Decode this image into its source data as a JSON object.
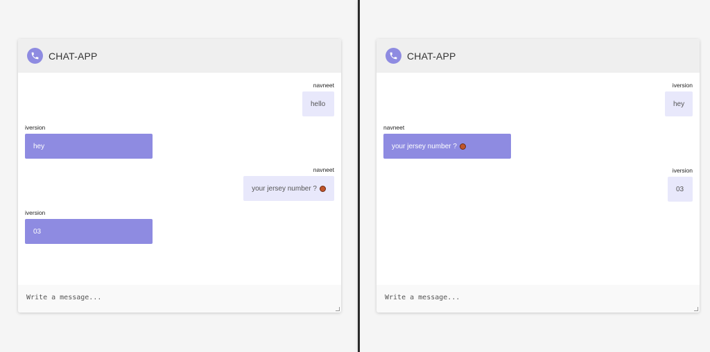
{
  "app": {
    "title": "CHAT-APP",
    "brand_color": "#8e8be1"
  },
  "composer": {
    "placeholder": "Write a message..."
  },
  "left_window": {
    "messages": [
      {
        "author": "navneet",
        "text": "hello",
        "direction": "out"
      },
      {
        "author": "iversion",
        "text": "hey",
        "direction": "in"
      },
      {
        "author": "navneet",
        "text": "your jersey number ?",
        "emoji": "basketball-icon",
        "direction": "out"
      },
      {
        "author": "iversion",
        "text": "03",
        "direction": "in"
      }
    ]
  },
  "right_window": {
    "messages": [
      {
        "author": "iversion",
        "text": "hey",
        "direction": "out"
      },
      {
        "author": "navneet",
        "text": "your jersey number ?",
        "emoji": "basketball-icon",
        "direction": "in"
      },
      {
        "author": "iversion",
        "text": "03",
        "direction": "out"
      }
    ]
  }
}
